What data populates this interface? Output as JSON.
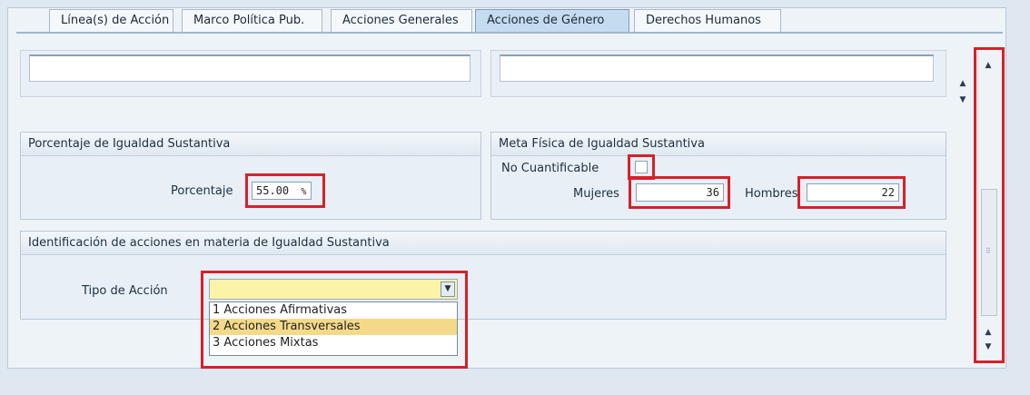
{
  "tabs": [
    {
      "label": "Línea(s) de Acción"
    },
    {
      "label": "Marco Política Pub."
    },
    {
      "label": "Acciones Generales"
    },
    {
      "label": "Acciones de Género"
    },
    {
      "label": "Derechos Humanos"
    }
  ],
  "active_tab": "Acciones de Género",
  "porcentaje_group": {
    "title": "Porcentaje de Igualdad Sustantiva",
    "label": "Porcentaje",
    "value": "55.00",
    "unit": "%"
  },
  "meta_group": {
    "title": "Meta Física de Igualdad Sustantiva",
    "no_cuantificable_label": "No Cuantificable",
    "no_cuantificable_checked": false,
    "mujeres_label": "Mujeres",
    "mujeres_value": "36",
    "hombres_label": "Hombres",
    "hombres_value": "22"
  },
  "identificacion_group": {
    "title": "Identificación de acciones en materia de Igualdad Sustantiva",
    "tipo_label": "Tipo de Acción",
    "tipo_value": "",
    "options": [
      {
        "label": "1 Acciones Afirmativas"
      },
      {
        "label": "2 Acciones Transversales"
      },
      {
        "label": "3 Acciones Mixtas"
      }
    ],
    "highlighted_option": "2 Acciones Transversales"
  },
  "colors": {
    "highlight_border": "#d7202a",
    "active_tab": "#c5dbf0",
    "dropdown_field": "#fbf3a7",
    "option_hover": "#f4d989"
  },
  "icons": {
    "scroll_up": "triangle-up-icon",
    "scroll_down": "triangle-down-icon",
    "dropdown": "chevron-down-icon",
    "grip": "grip-icon"
  }
}
